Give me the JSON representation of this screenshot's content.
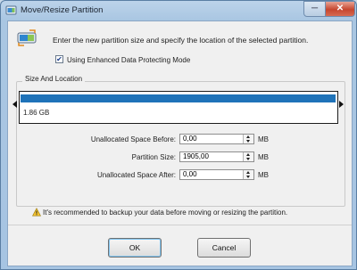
{
  "window": {
    "title": "Move/Resize Partition",
    "min_symbol": "─",
    "close_symbol": "✕"
  },
  "header": {
    "instruction": "Enter the new partition size and specify the location of the selected partition.",
    "enhanced_mode_label": "Using Enhanced Data Protecting Mode",
    "enhanced_mode_checked": true,
    "check_mark": "✔"
  },
  "group": {
    "title": "Size And Location",
    "partition_size_label": "1.86 GB",
    "bar_color": "#1f73b9"
  },
  "fields": {
    "unallocated_before": {
      "label": "Unallocated Space Before:",
      "value": "0,00",
      "unit": "MB"
    },
    "partition_size": {
      "label": "Partition Size:",
      "value": "1905,00",
      "unit": "MB"
    },
    "unallocated_after": {
      "label": "Unallocated Space After:",
      "value": "0,00",
      "unit": "MB"
    }
  },
  "warning": {
    "text": "It's recommended to backup your data before moving or resizing the partition."
  },
  "buttons": {
    "ok": "OK",
    "cancel": "Cancel"
  }
}
